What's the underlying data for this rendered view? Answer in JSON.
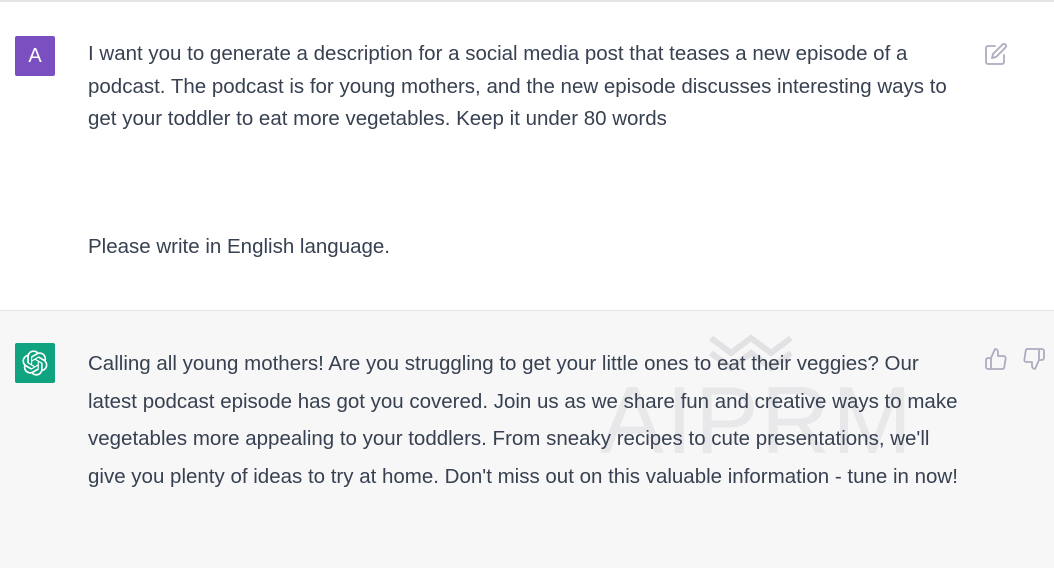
{
  "user_message": {
    "avatar_letter": "A",
    "text": "I want you to generate a description for a social media post that teases a new episode of a podcast. The podcast is for young mothers, and the new episode discusses interesting ways to get your toddler to eat more vegetables. Keep it under 80 words",
    "language_line": "Please write in English language.",
    "edit_icon": "edit-icon"
  },
  "assistant_message": {
    "avatar_icon": "openai-logo-icon",
    "text": "Calling all young mothers! Are you struggling to get your little ones to eat their veggies? Our latest podcast episode has got you covered. Join us as we share fun and creative ways to make vegetables more appealing to your toddlers. From sneaky recipes to cute presentations, we'll give you plenty of ideas to try at home. Don't miss out on this valuable information - tune in now!",
    "thumbs_up_icon": "thumbs-up-icon",
    "thumbs_down_icon": "thumbs-down-icon"
  },
  "watermark_text": "AIPRM",
  "colors": {
    "user_avatar": "#7a4fc0",
    "assistant_avatar": "#10a37f",
    "assistant_bg": "#f7f7f8",
    "text": "#374151",
    "icon": "#acacbe"
  }
}
